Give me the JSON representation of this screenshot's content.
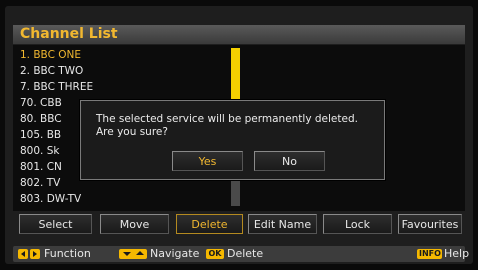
{
  "title": "Channel List",
  "channels": [
    {
      "label": "1. BBC ONE",
      "selected": true
    },
    {
      "label": "2. BBC TWO",
      "selected": false
    },
    {
      "label": "7. BBC THREE",
      "selected": false
    },
    {
      "label": "70. CBB",
      "selected": false
    },
    {
      "label": "80. BBC",
      "selected": false
    },
    {
      "label": "105. BB",
      "selected": false
    },
    {
      "label": "800. Sk",
      "selected": false
    },
    {
      "label": "801. CN",
      "selected": false
    },
    {
      "label": "802. TV",
      "selected": false
    },
    {
      "label": "803. DW-TV",
      "selected": false
    }
  ],
  "buttons": [
    "Select",
    "Move",
    "Delete",
    "Edit Name",
    "Lock",
    "Favourites"
  ],
  "active_button": "Delete",
  "dialog": {
    "line1": "The selected service will be permanently deleted.",
    "line2": "Are you sure?",
    "yes": "Yes",
    "no": "No"
  },
  "footer": {
    "function": "Function",
    "navigate": "Navigate",
    "ok_key": "OK",
    "delete": "Delete",
    "info_key": "INFO",
    "help": "Help"
  },
  "colors": {
    "accent": "#f2b830",
    "key": "#f5b800",
    "scroll_thumb": "#f5d000"
  }
}
